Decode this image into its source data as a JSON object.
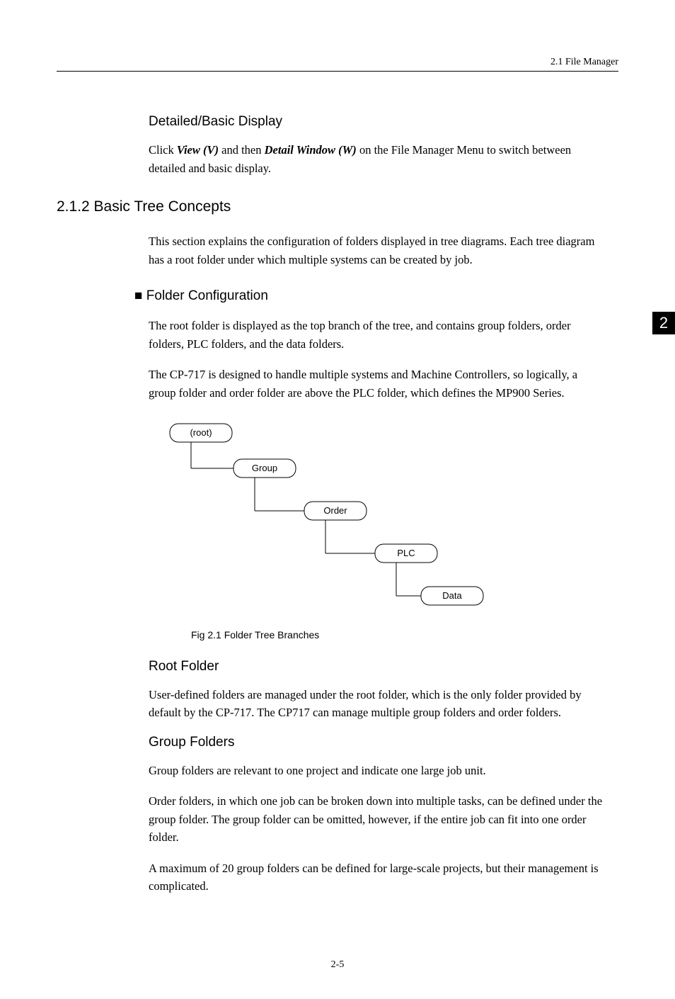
{
  "header": {
    "breadcrumb": "2.1  File Manager"
  },
  "tab": {
    "number": "2"
  },
  "section1": {
    "heading": "Detailed/Basic Display",
    "para_pre": "Click ",
    "para_b1": "View (V)",
    "para_mid": " and then ",
    "para_b2": "Detail Window (W)",
    "para_post": " on the File Manager Menu to switch between detailed and basic display."
  },
  "section2": {
    "number_heading": "2.1.2  Basic Tree Concepts",
    "para1": "This section explains the configuration of folders displayed in tree diagrams. Each tree diagram has a root folder under which multiple systems can be created by job."
  },
  "folderconfig": {
    "heading": "Folder Configuration",
    "para1": "The root folder is displayed as the top branch of the tree, and contains group folders, order folders, PLC folders, and the data folders.",
    "para2": "The CP-717 is designed to handle multiple systems and Machine Controllers, so logically, a group folder and order folder are above the PLC folder, which defines the MP900 Series."
  },
  "diagram": {
    "nodes": {
      "root": "(root)",
      "group": "Group",
      "order": "Order",
      "plc": "PLC",
      "data": "Data"
    },
    "caption": "Fig 2.1  Folder Tree Branches"
  },
  "rootfolder": {
    "heading": "Root Folder",
    "para1": "User-defined folders are managed under the root folder, which is the only folder provided by default by the CP-717. The CP717 can manage multiple group folders and order folders."
  },
  "groupfolders": {
    "heading": "Group Folders",
    "para1": "Group folders are relevant to one project and indicate one large job unit.",
    "para2": "Order folders, in which one job can be broken down into multiple tasks, can be defined under the group folder. The group folder can be omitted, however, if the entire job can fit into one order folder.",
    "para3": "A maximum of 20 group folders can be defined for large-scale projects, but their management is complicated."
  },
  "footer": {
    "page": "2-5"
  }
}
